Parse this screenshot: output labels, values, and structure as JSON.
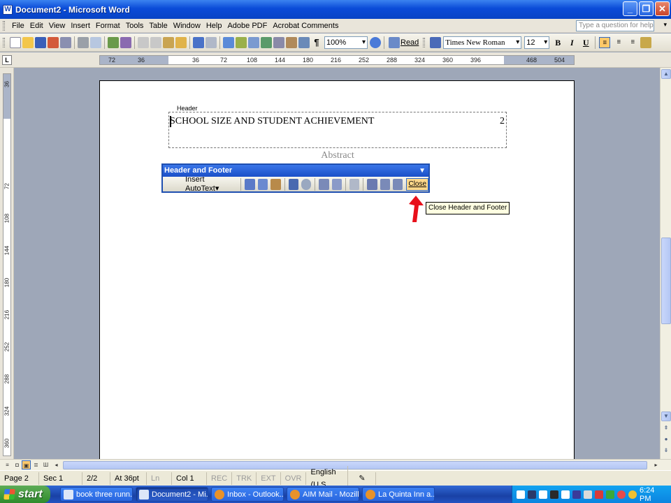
{
  "window": {
    "title": "Document2 - Microsoft Word",
    "minimize": "_",
    "restore": "❐",
    "close": "✕"
  },
  "menu": {
    "items": [
      "File",
      "Edit",
      "View",
      "Insert",
      "Format",
      "Tools",
      "Table",
      "Window",
      "Help",
      "Adobe PDF",
      "Acrobat Comments"
    ],
    "help_placeholder": "Type a question for help"
  },
  "toolbar": {
    "zoom": "100%",
    "read_label": "Read",
    "font": "Times New Roman",
    "size": "12",
    "bold": "B",
    "italic": "I",
    "underline": "U"
  },
  "ruler": {
    "h_ticks": [
      "72",
      "36",
      "36",
      "72",
      "108",
      "144",
      "180",
      "216",
      "252",
      "288",
      "324",
      "360",
      "396",
      "468",
      "504"
    ],
    "v_ticks": [
      "36",
      "72",
      "108",
      "144",
      "180",
      "216",
      "252",
      "288",
      "324",
      "360"
    ]
  },
  "document": {
    "header_label": "Header",
    "header_text": "SCHOOL SIZE AND STUDENT ACHIEVEMENT",
    "page_number": "2",
    "abstract": "Abstract"
  },
  "hf_toolbar": {
    "title": "Header and Footer",
    "insert_autotext": "Insert AutoText",
    "close": "Close"
  },
  "tooltip": "Close Header and Footer",
  "status": {
    "page": "Page 2",
    "sec": "Sec 1",
    "pages": "2/2",
    "at": "At 36pt",
    "ln": "Ln",
    "col": "Col 1",
    "rec": "REC",
    "trk": "TRK",
    "ext": "EXT",
    "ovr": "OVR",
    "lang": "English (U.S."
  },
  "taskbar": {
    "start": "start",
    "tasks": [
      "book three runn...",
      "Document2 - Mi...",
      "Inbox - Outlook...",
      "AIM Mail - Mozilla...",
      "La Quinta Inn a..."
    ],
    "clock": "6:24 PM"
  }
}
